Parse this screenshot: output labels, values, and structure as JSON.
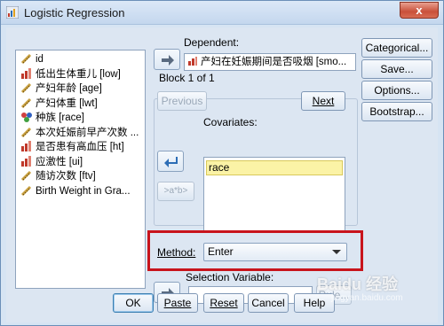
{
  "window": {
    "title": "Logistic Regression",
    "close_glyph": "x"
  },
  "variables": [
    {
      "name": "id",
      "icon": "scale-icon"
    },
    {
      "name": "低出生体重儿 [low]",
      "icon": "bar-icon"
    },
    {
      "name": "产妇年龄 [age]",
      "icon": "scale-icon"
    },
    {
      "name": "产妇体重 [lwt]",
      "icon": "scale-icon"
    },
    {
      "name": "种族 [race]",
      "icon": "nominal-icon"
    },
    {
      "name": "本次妊娠前早产次数 ...",
      "icon": "scale-icon"
    },
    {
      "name": "是否患有高血压 [ht]",
      "icon": "bar-icon"
    },
    {
      "name": "应激性 [ui]",
      "icon": "bar-icon"
    },
    {
      "name": "随访次数 [ftv]",
      "icon": "scale-icon"
    },
    {
      "name": "Birth Weight in Gra...",
      "icon": "scale-icon"
    }
  ],
  "dependent": {
    "label": "Dependent:",
    "value": "产妇在妊娠期间是否吸烟 [smo..."
  },
  "block": {
    "label": "Block 1 of 1",
    "previous_label": "Previous",
    "next_label": "Next",
    "covariates_label": "Covariates:",
    "covariates": [
      "race"
    ],
    "interaction_label": ">a*b>"
  },
  "method": {
    "label": "Method:",
    "value": "Enter"
  },
  "selection": {
    "label": "Selection Variable:",
    "rule_label": "Rule..."
  },
  "side_buttons": {
    "categorical": "Categorical...",
    "save": "Save...",
    "options": "Options...",
    "bootstrap": "Bootstrap..."
  },
  "bottom_buttons": {
    "ok": "OK",
    "paste": "Paste",
    "reset": "Reset",
    "cancel": "Cancel",
    "help": "Help"
  },
  "watermark": {
    "text": "Baidu 经验",
    "sub": "jingyan.baidu.com"
  },
  "colors": {
    "highlight_frame": "#c8141c",
    "selected_item": "#fbf3a6",
    "window_bg": "#d6e4f3"
  }
}
